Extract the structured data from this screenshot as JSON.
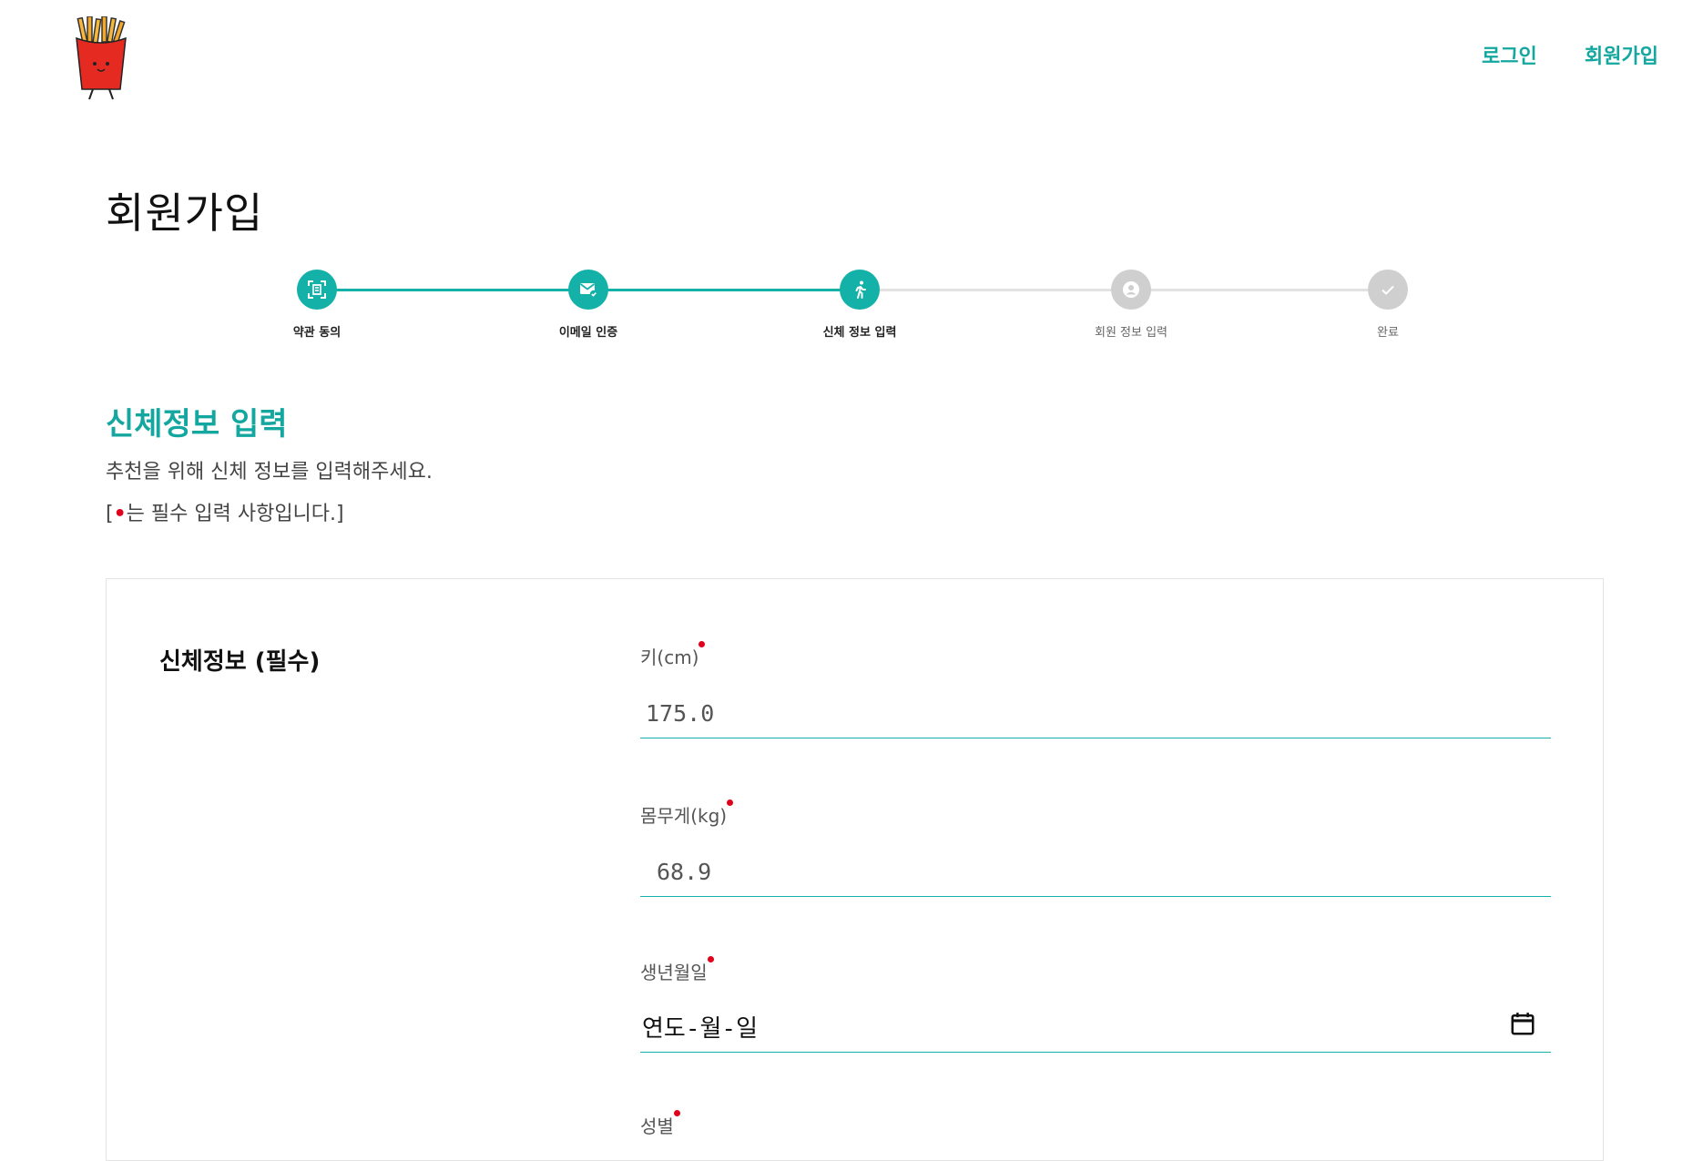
{
  "header": {
    "login_label": "로그인",
    "signup_label": "회원가입"
  },
  "page": {
    "title": "회원가입"
  },
  "stepper": {
    "steps": [
      {
        "label": "약관 동의",
        "icon": "document-scan-icon",
        "state": "completed"
      },
      {
        "label": "이메일 인증",
        "icon": "mail-check-icon",
        "state": "completed"
      },
      {
        "label": "신체 정보 입력",
        "icon": "running-person-icon",
        "state": "current"
      },
      {
        "label": "회원 정보 입력",
        "icon": "user-circle-icon",
        "state": "pending"
      },
      {
        "label": "완료",
        "icon": "check-icon",
        "state": "pending"
      }
    ]
  },
  "section": {
    "title": "신체정보 입력",
    "desc1": "추천을 위해 신체 정보를 입력해주세요.",
    "desc2_pre": "[",
    "desc2_dot": "•",
    "desc2_post": "는 필수 입력 사항입니다.]"
  },
  "form": {
    "group_label": "신체정보 (필수)",
    "height": {
      "label": "키(cm)",
      "value": "175.0"
    },
    "weight": {
      "label": "몸무게(kg)",
      "value": "68.9"
    },
    "birth": {
      "label": "생년월일",
      "value": "연도-월-일"
    },
    "gender": {
      "label": "성별"
    }
  },
  "colors": {
    "accent": "#14b1a8",
    "nav_text": "#14a7a0",
    "required_dot": "#e0001b",
    "inactive_step": "#cfcfcf"
  }
}
